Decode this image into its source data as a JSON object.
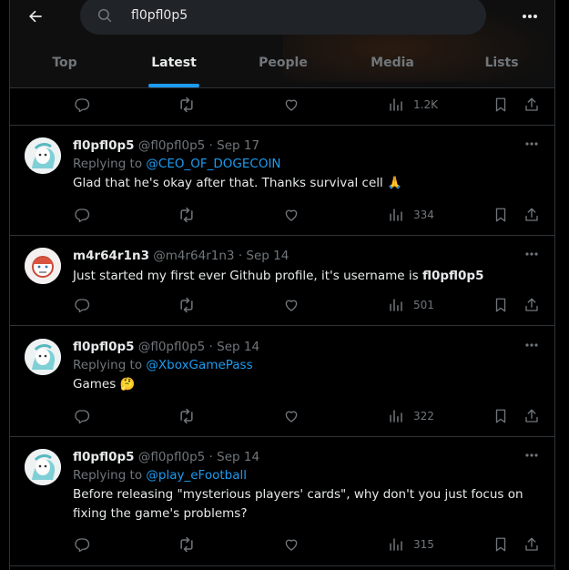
{
  "search": {
    "value": "fl0pfl0p5"
  },
  "tabs": [
    {
      "label": "Top",
      "active": false
    },
    {
      "label": "Latest",
      "active": true
    },
    {
      "label": "People",
      "active": false
    },
    {
      "label": "Media",
      "active": false
    },
    {
      "label": "Lists",
      "active": false
    }
  ],
  "colors": {
    "accent": "#1d9bf0",
    "muted": "#71767b",
    "text": "#e7e9ea",
    "border": "#2f3336"
  },
  "prev_tweet": {
    "views": "1.2K"
  },
  "tweets": [
    {
      "name": "fl0pfl0p5",
      "handle": "@fl0pfl0p5",
      "dot": "·",
      "date": "Sep 17",
      "replying_prefix": "Replying to",
      "replying_to": "@CEO_OF_DOGECOIN",
      "text": "Glad that he's okay after that. Thanks survival cell 🙏",
      "views": "334"
    },
    {
      "name": "m4r64r1n3",
      "handle": "@m4r64r1n3",
      "dot": "·",
      "date": "Sep 14",
      "text": "Just started my first ever Github profile, it's username is ",
      "text_bold": "fl0pfl0p5",
      "views": "501"
    },
    {
      "name": "fl0pfl0p5",
      "handle": "@fl0pfl0p5",
      "dot": "·",
      "date": "Sep 14",
      "replying_prefix": "Replying to",
      "replying_to": "@XboxGamePass",
      "text": "Games 🤔",
      "views": "322"
    },
    {
      "name": "fl0pfl0p5",
      "handle": "@fl0pfl0p5",
      "dot": "·",
      "date": "Sep 14",
      "replying_prefix": "Replying to",
      "replying_to": "@play_eFootball",
      "text": "Before releasing \"mysterious players' cards\", why don't you just focus on fixing the game's problems?",
      "views": "315"
    }
  ]
}
